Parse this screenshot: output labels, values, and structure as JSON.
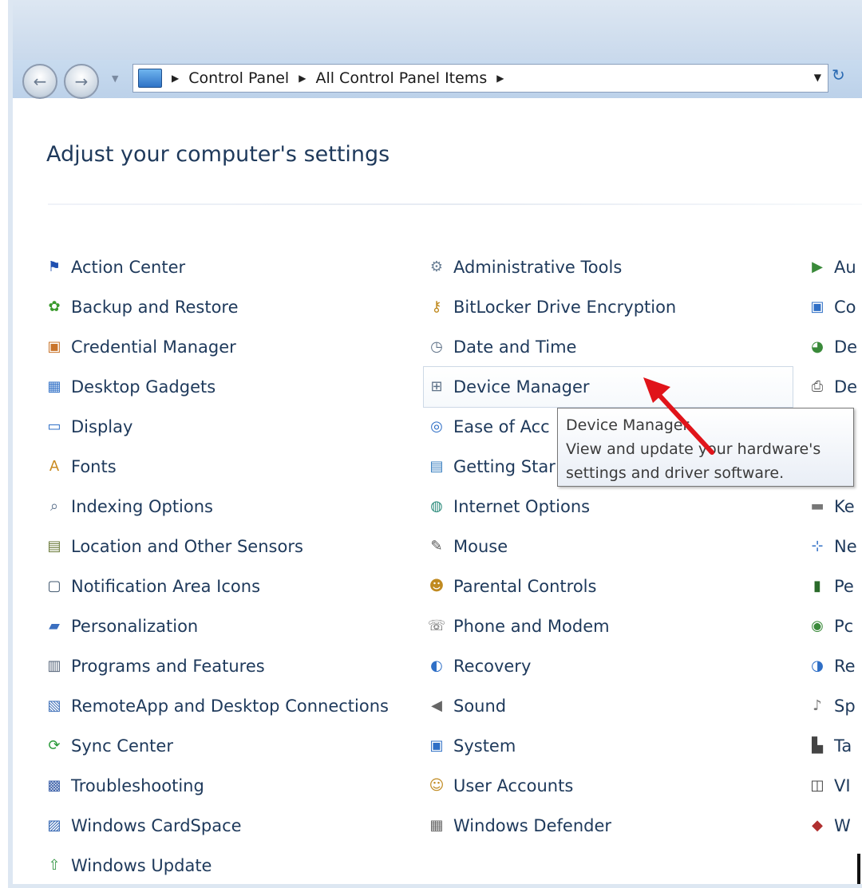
{
  "nav": {
    "back_label": "",
    "forward_label": "",
    "breadcrumbs": [
      "Control Panel",
      "All Control Panel Items"
    ]
  },
  "page": {
    "title": "Adjust your computer's settings"
  },
  "columns": [
    {
      "items": [
        {
          "label": "Action Center",
          "icon": "flag-icon"
        },
        {
          "label": "Backup and Restore",
          "icon": "backup-icon"
        },
        {
          "label": "Credential Manager",
          "icon": "vault-icon"
        },
        {
          "label": "Desktop Gadgets",
          "icon": "gadgets-icon"
        },
        {
          "label": "Display",
          "icon": "monitor-icon"
        },
        {
          "label": "Fonts",
          "icon": "fonts-icon"
        },
        {
          "label": "Indexing Options",
          "icon": "indexing-icon"
        },
        {
          "label": "Location and Other Sensors",
          "icon": "sensors-icon"
        },
        {
          "label": "Notification Area Icons",
          "icon": "notification-icon"
        },
        {
          "label": "Personalization",
          "icon": "personalization-icon"
        },
        {
          "label": "Programs and Features",
          "icon": "programs-icon"
        },
        {
          "label": "RemoteApp and Desktop Connections",
          "icon": "remoteapp-icon"
        },
        {
          "label": "Sync Center",
          "icon": "sync-icon"
        },
        {
          "label": "Troubleshooting",
          "icon": "troubleshoot-icon"
        },
        {
          "label": "Windows CardSpace",
          "icon": "cardspace-icon"
        },
        {
          "label": "Windows Update",
          "icon": "update-icon"
        }
      ]
    },
    {
      "items": [
        {
          "label": "Administrative Tools",
          "icon": "admin-tools-icon"
        },
        {
          "label": "BitLocker Drive Encryption",
          "icon": "bitlocker-icon"
        },
        {
          "label": "Date and Time",
          "icon": "clock-icon"
        },
        {
          "label": "Device Manager",
          "icon": "device-manager-icon"
        },
        {
          "label": "Ease of Acc",
          "icon": "ease-of-access-icon"
        },
        {
          "label": "Getting Star",
          "icon": "getting-started-icon"
        },
        {
          "label": "Internet Options",
          "icon": "internet-options-icon"
        },
        {
          "label": "Mouse",
          "icon": "mouse-icon"
        },
        {
          "label": "Parental Controls",
          "icon": "parental-icon"
        },
        {
          "label": "Phone and Modem",
          "icon": "phone-icon"
        },
        {
          "label": "Recovery",
          "icon": "recovery-icon"
        },
        {
          "label": "Sound",
          "icon": "speaker-icon"
        },
        {
          "label": "System",
          "icon": "system-icon"
        },
        {
          "label": "User Accounts",
          "icon": "users-icon"
        },
        {
          "label": "Windows Defender",
          "icon": "defender-icon"
        }
      ]
    },
    {
      "items": [
        {
          "label": "Au",
          "icon": "autoplay-icon"
        },
        {
          "label": "Co",
          "icon": "color-icon"
        },
        {
          "label": "De",
          "icon": "default-programs-icon"
        },
        {
          "label": "De",
          "icon": "devices-printers-icon"
        },
        {
          "label": "",
          "icon": ""
        },
        {
          "label": "",
          "icon": ""
        },
        {
          "label": "Ke",
          "icon": "keyboard-icon"
        },
        {
          "label": "Ne",
          "icon": "network-icon"
        },
        {
          "label": "Pe",
          "icon": "performance-icon"
        },
        {
          "label": "Pc",
          "icon": "power-icon"
        },
        {
          "label": "Re",
          "icon": "region-icon"
        },
        {
          "label": "Sp",
          "icon": "speech-icon"
        },
        {
          "label": "Ta",
          "icon": "taskbar-icon"
        },
        {
          "label": "VI",
          "icon": "vpn-icon"
        },
        {
          "label": "W",
          "icon": "firewall-icon"
        }
      ]
    }
  ],
  "tooltip": {
    "title": "Device Manager",
    "line1": "View and update your hardware's",
    "line2": "settings and driver software."
  },
  "colors": {
    "link": "#1e395b",
    "arrow": "#e0141a",
    "navbar": "#c8dbef"
  }
}
